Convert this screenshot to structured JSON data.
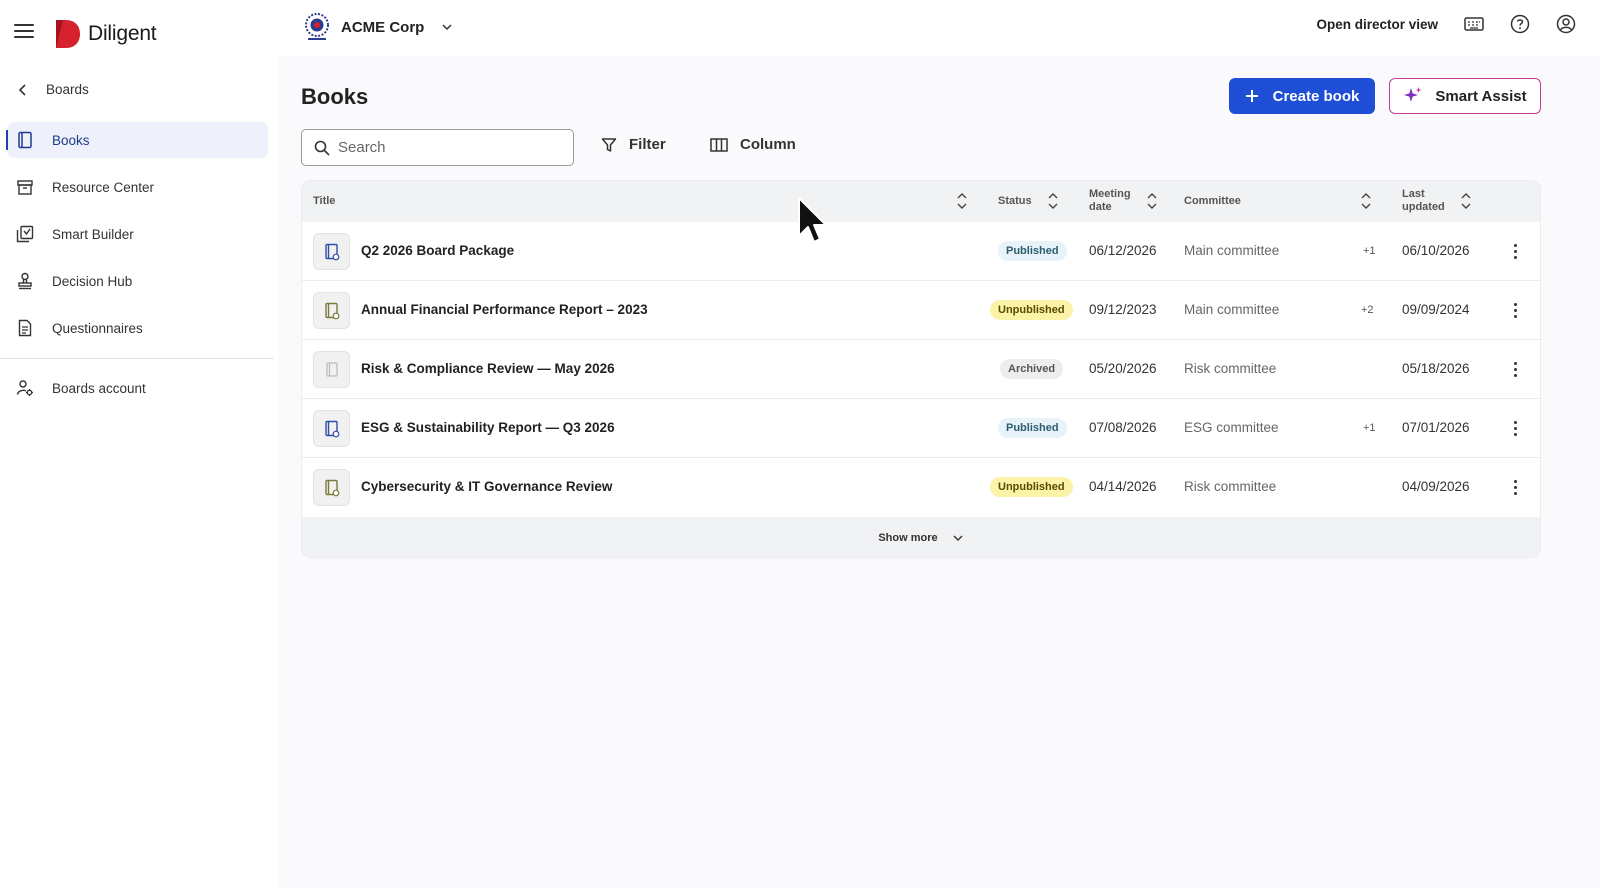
{
  "header": {
    "app_name": "Diligent",
    "org_name": "ACME Corp",
    "director_view_label": "Open director view"
  },
  "sidebar": {
    "back_label": "Boards",
    "items": [
      {
        "label": "Books",
        "icon": "book-icon",
        "active": true
      },
      {
        "label": "Resource Center",
        "icon": "archive-icon",
        "active": false
      },
      {
        "label": "Smart Builder",
        "icon": "smart-builder-icon",
        "active": false
      },
      {
        "label": "Decision Hub",
        "icon": "stamp-icon",
        "active": false
      },
      {
        "label": "Questionnaires",
        "icon": "document-icon",
        "active": false
      }
    ],
    "account_label": "Boards account"
  },
  "main": {
    "title": "Books",
    "create_label": "Create book",
    "smart_assist_label": "Smart Assist",
    "search_placeholder": "Search",
    "filter_label": "Filter",
    "column_label": "Column",
    "show_more_label": "Show more"
  },
  "table": {
    "headers": {
      "title": "Title",
      "status": "Status",
      "meeting_date_1": "Meeting",
      "meeting_date_2": "date",
      "committee": "Committee",
      "last_updated_1": "Last",
      "last_updated_2": "updated"
    },
    "rows": [
      {
        "title": "Q2 2026 Board Package",
        "status": "Published",
        "meeting_date": "06/12/2026",
        "committee": "Main committee",
        "extra": "+1",
        "last_updated": "06/10/2026"
      },
      {
        "title": "Annual Financial Performance Report – 2023",
        "status": "Unpublished",
        "meeting_date": "09/12/2023",
        "committee": "Main committee",
        "extra": "+2",
        "last_updated": "09/09/2024"
      },
      {
        "title": "Risk & Compliance Review — May 2026",
        "status": "Archived",
        "meeting_date": "05/20/2026",
        "committee": "Risk committee",
        "extra": "",
        "last_updated": "05/18/2026"
      },
      {
        "title": "ESG & Sustainability Report — Q3 2026",
        "status": "Published",
        "meeting_date": "07/08/2026",
        "committee": "ESG committee",
        "extra": "+1",
        "last_updated": "07/01/2026"
      },
      {
        "title": "Cybersecurity & IT Governance Review",
        "status": "Unpublished",
        "meeting_date": "04/14/2026",
        "committee": "Risk committee",
        "extra": "",
        "last_updated": "04/09/2026"
      }
    ]
  },
  "colors": {
    "brand_red": "#d6212f",
    "primary_blue": "#1f4fd6",
    "smart_assist_accent": "#c03a9b",
    "published_bg": "#e7f3f8",
    "unpublished_bg": "#fbf3a8",
    "archived_bg": "#ededed"
  }
}
